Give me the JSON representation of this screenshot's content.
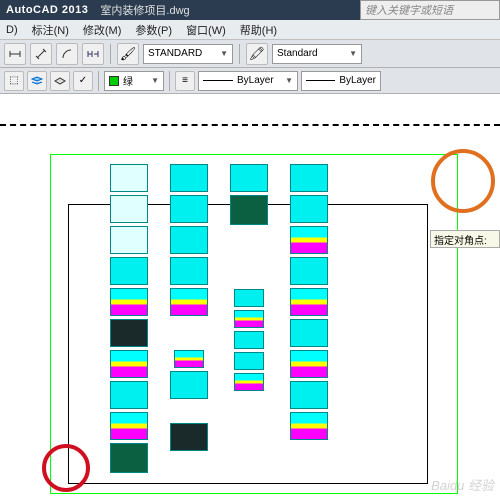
{
  "title": {
    "app": "AutoCAD 2013",
    "file": "室内装修项目.dwg"
  },
  "search": {
    "placeholder": "键入关键字或短语"
  },
  "menu": {
    "d": "D)",
    "annotate": "标注(N)",
    "modify": "修改(M)",
    "param": "参数(P)",
    "window": "窗口(W)",
    "help": "帮助(H)"
  },
  "toolbar1": {
    "style1": "STANDARD",
    "style2": "Standard"
  },
  "toolbar2": {
    "layer_name": "绿",
    "linetype1": "ByLayer",
    "linetype2": "ByLayer"
  },
  "tooltip": "指定对角点:",
  "watermark": "Baidu 经验"
}
